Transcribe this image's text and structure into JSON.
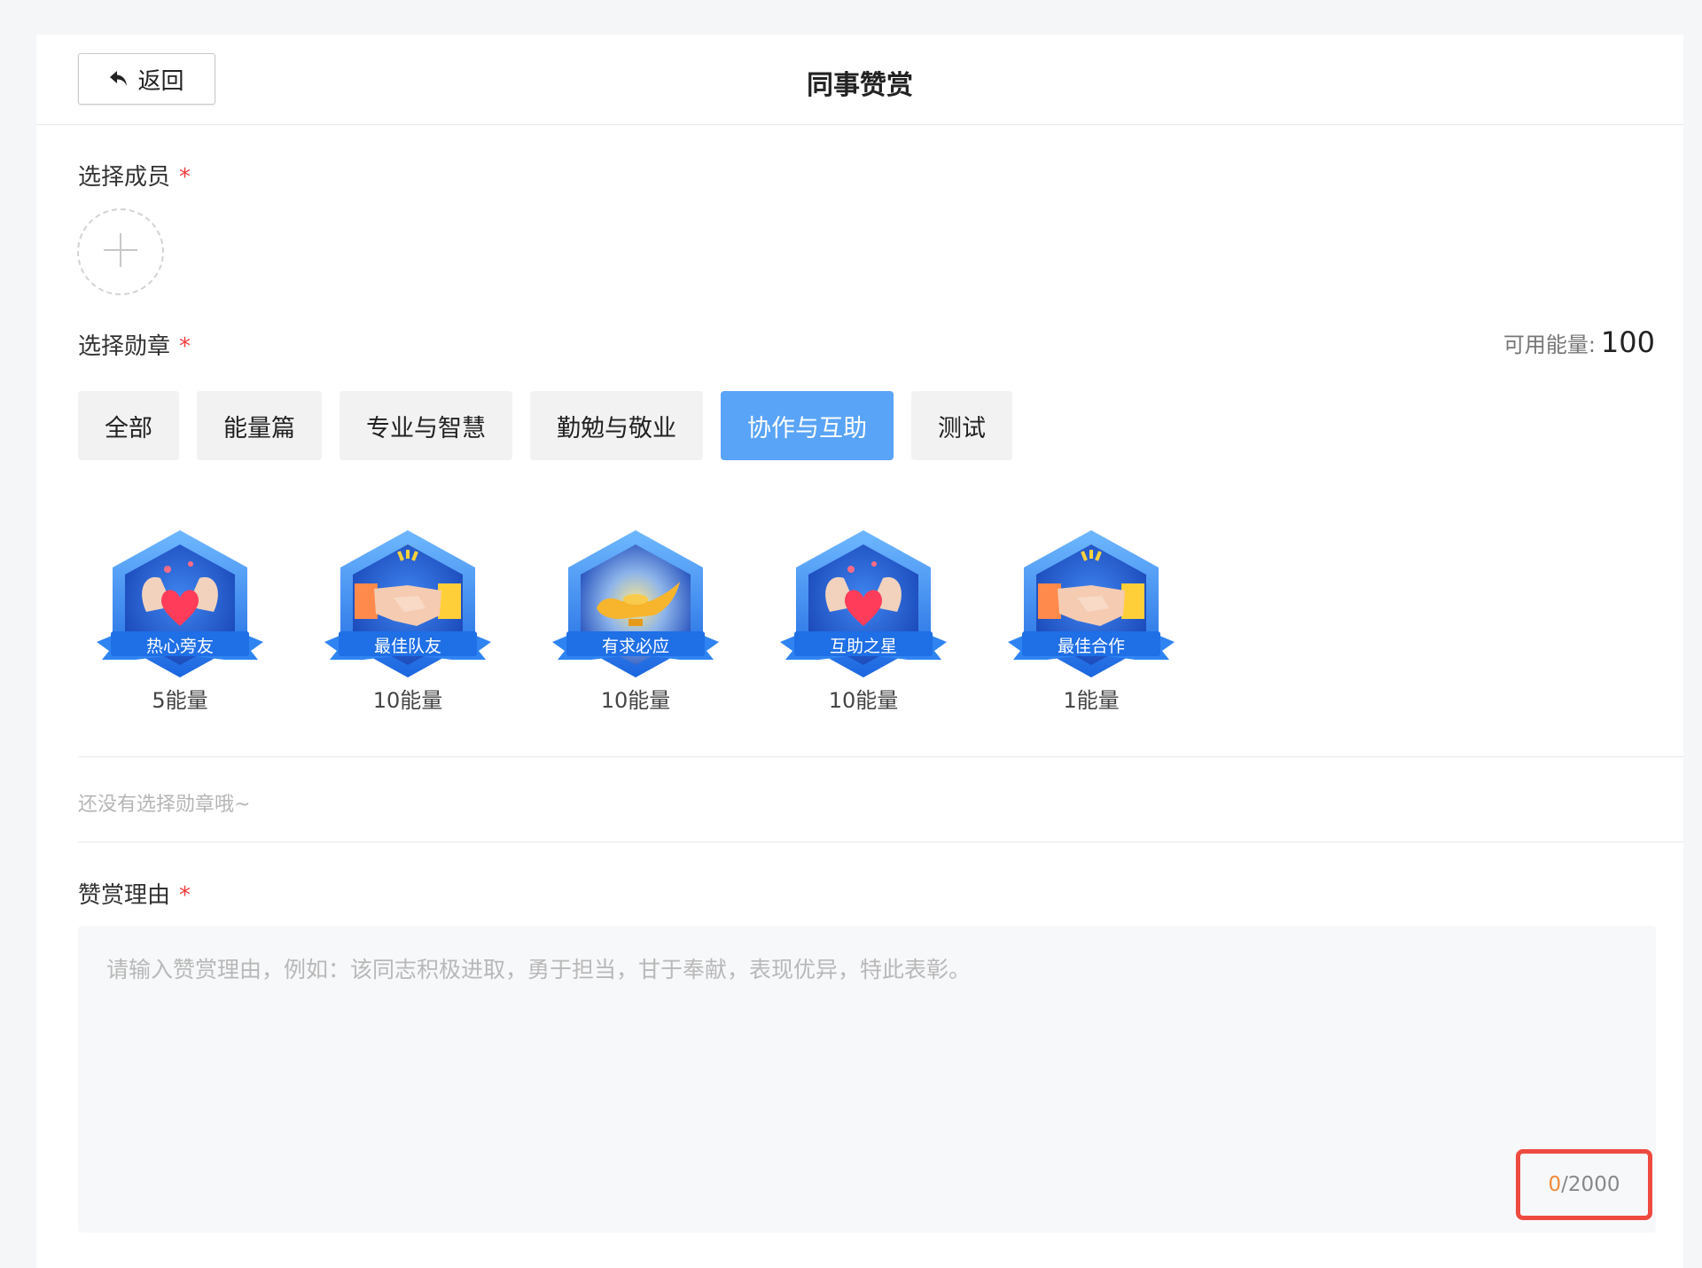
{
  "header": {
    "back_label": "返回",
    "title": "同事赞赏"
  },
  "member_section": {
    "label": "选择成员",
    "required_mark": "*"
  },
  "medal_section": {
    "label": "选择勋章",
    "required_mark": "*",
    "energy_label": "可用能量:",
    "energy_value": "100",
    "tabs": [
      {
        "label": "全部",
        "active": false
      },
      {
        "label": "能量篇",
        "active": false
      },
      {
        "label": "专业与智慧",
        "active": false
      },
      {
        "label": "勤勉与敬业",
        "active": false
      },
      {
        "label": "协作与互助",
        "active": true
      },
      {
        "label": "测试",
        "active": false
      }
    ],
    "badges": [
      {
        "name": "热心旁友",
        "cost": "5能量",
        "icon": "heart-hands-icon"
      },
      {
        "name": "最佳队友",
        "cost": "10能量",
        "icon": "handshake-icon"
      },
      {
        "name": "有求必应",
        "cost": "10能量",
        "icon": "magic-lamp-icon"
      },
      {
        "name": "互助之星",
        "cost": "10能量",
        "icon": "heart-hands-icon"
      },
      {
        "name": "最佳合作",
        "cost": "1能量",
        "icon": "handshake-icon"
      }
    ],
    "empty_hint": "还没有选择勋章哦~"
  },
  "reason_section": {
    "label": "赞赏理由",
    "required_mark": "*",
    "value": "",
    "placeholder": "请输入赞赏理由，例如：该同志积极进取，勇于担当，甘于奉献，表现优异，特此表彰。",
    "count_current": "0",
    "count_max": "/2000"
  },
  "colors": {
    "accent": "#5aa4f7",
    "required": "#f03c3c",
    "highlight_border": "#ee4a3f",
    "counter_current": "#f08a3c"
  }
}
